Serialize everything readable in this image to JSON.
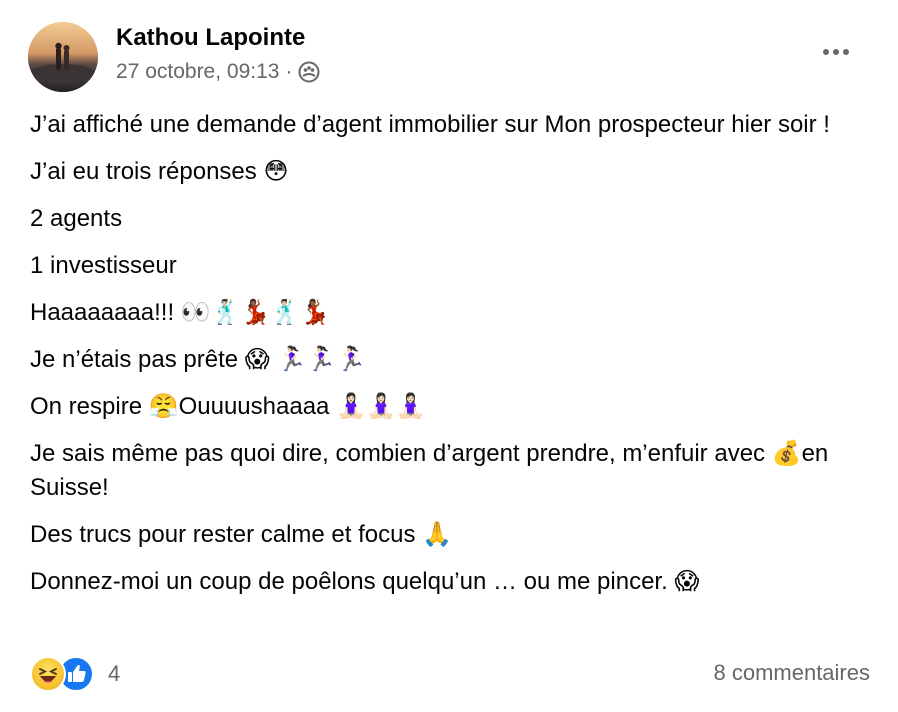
{
  "post": {
    "author": "Kathou Lapointe",
    "timestamp": "27 octobre, 09:13",
    "separator": "·",
    "privacy_icon": "group-icon",
    "more_icon": "ellipsis-icon",
    "paragraphs": [
      "J’ai affiché une demande d’agent immobilier sur Mon prospecteur hier soir !",
      "J’ai eu trois réponses 😳",
      "2 agents",
      "1 investisseur",
      "Haaaaaaaa!!! 👀🕺🏻💃🏾🕺🏻💃🏾",
      "Je n’étais pas prête 😱 🏃🏻‍♀️🏃🏻‍♀️🏃🏻‍♀️",
      "On respire  😤Ouuuushaaaa 🧘🏻‍♀️🧘🏻‍♀️🧘🏻‍♀️",
      "Je sais même pas quoi dire, combien d’argent prendre, m’enfuir avec 💰en Suisse!",
      "Des trucs pour rester calme et focus 🙏",
      "Donnez-moi un coup de poêlons quelqu’un … ou me pincer. 😱"
    ]
  },
  "footer": {
    "reaction_icons": [
      "haha-reaction-icon",
      "like-reaction-icon"
    ],
    "reaction_count": "4",
    "comments_label": "8 commentaires"
  },
  "colors": {
    "text": "#050505",
    "secondary": "#65676b",
    "like_blue": "#1877f2",
    "haha_yellow": "#f7c530"
  }
}
